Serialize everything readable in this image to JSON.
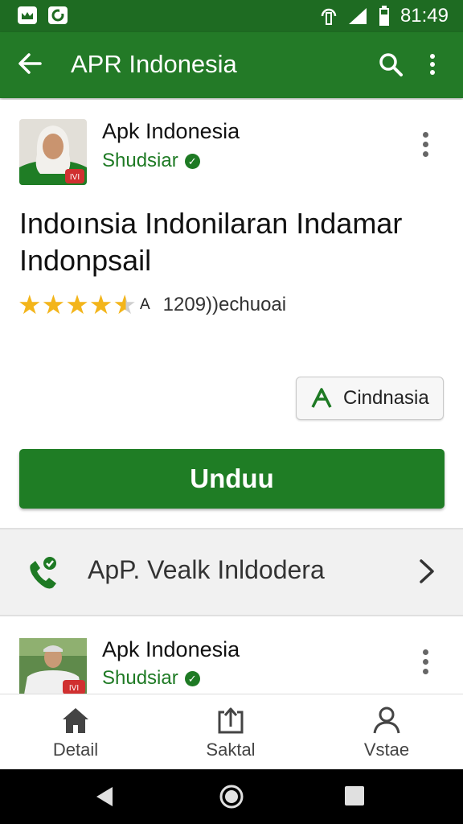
{
  "status": {
    "time": "81:49"
  },
  "appbar": {
    "title": "APR Indonesia",
    "back_icon": "arrow-back-icon",
    "search_icon": "search-icon",
    "more_icon": "more-vert-icon"
  },
  "app": {
    "developer": "Apk Indonesia",
    "developer_sub": "Shudsiar",
    "title": "Indoınsia Indonilaran Indamar Indonpsail",
    "rating_value": 4.5,
    "rating_prefix": "A",
    "rating_count": "1209))echuoai",
    "category": "Cindnasia",
    "install_label": "Unduu",
    "avatar_badge": "IVI"
  },
  "row": {
    "label": "ApP. Vealk Inldodera"
  },
  "second": {
    "developer": "Apk Indonesia",
    "developer_sub": "Shudsiar",
    "avatar_badge": "IVI"
  },
  "nav": {
    "items": [
      {
        "label": "Detail"
      },
      {
        "label": "Saktal"
      },
      {
        "label": "Vstae"
      }
    ]
  },
  "colors": {
    "primary": "#237a27",
    "status": "#1e6b22",
    "accent": "#1f7d25",
    "star": "#f3b51b"
  }
}
